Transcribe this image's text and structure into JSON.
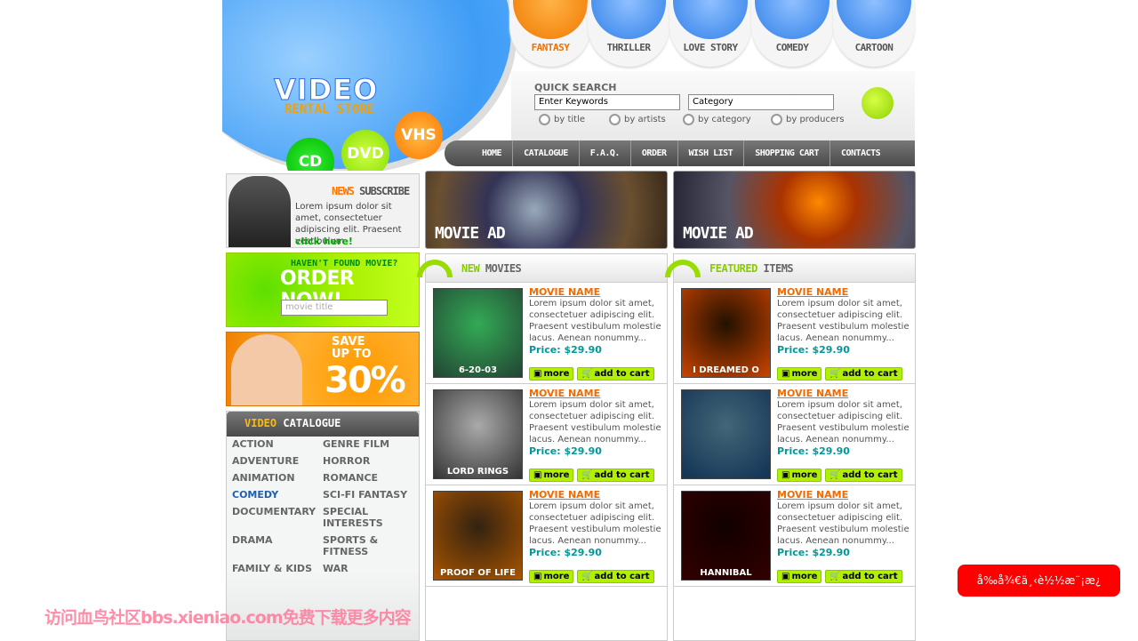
{
  "logo": {
    "title": "VIDEO",
    "subtitle": "RENTAL STORE"
  },
  "media": [
    "CD",
    "DVD",
    "VHS"
  ],
  "genres": [
    {
      "label": "FANTASY",
      "active": true
    },
    {
      "label": "THRILLER"
    },
    {
      "label": "LOVE STORY"
    },
    {
      "label": "COMEDY"
    },
    {
      "label": "CARTOON"
    }
  ],
  "search": {
    "title": "QUICK SEARCH",
    "keywords": "Enter Keywords",
    "category": "Category",
    "options": [
      "by title",
      "by artists",
      "by category",
      "by producers"
    ]
  },
  "nav": [
    "HOME",
    "CATALOGUE",
    "F.A.Q.",
    "ORDER",
    "WISH LIST",
    "SHOPPING CART",
    "CONTACTS"
  ],
  "news": {
    "title_a": "NEWS",
    "title_b": "SUBSCRIBE",
    "text": "Lorem ipsum dolor sit amet, consectetuer adipiscing elit. Praesent vestibulum",
    "link": "click here!"
  },
  "order": {
    "line1": "HAVEN'T FOUND MOVIE?",
    "line2": "ORDER NOW!",
    "placeholder": "movie title"
  },
  "save": {
    "line1": "SAVE",
    "line2": "UP TO",
    "line3": "30%"
  },
  "catalogue": {
    "title_a": "VIDEO",
    "title_b": "CATALOGUE",
    "left": [
      "ACTION",
      "ADVENTURE",
      "ANIMATION",
      "COMEDY",
      "DOCUMENTARY",
      "DRAMA",
      "FAMILY & KIDS"
    ],
    "right": [
      "GENRE FILM",
      "HORROR",
      "ROMANCE",
      "SCI-FI FANTASY",
      "SPECIAL INTERESTS",
      "SPORTS & FITNESS",
      "WAR"
    ],
    "active": "COMEDY",
    "active_color": "#1f5fb0"
  },
  "ads": [
    "MOVIE AD",
    "MOVIE AD"
  ],
  "panels": [
    {
      "title_a": "NEW",
      "title_b": "MOVIES",
      "items": [
        {
          "name": "MOVIE NAME",
          "desc": "Lorem ipsum dolor sit amet, consectetuer adipiscing elit. Praesent vestibulum molestie lacus. Aenean nonummy...",
          "price": "Price: $29.90",
          "poster": "6-20-03"
        },
        {
          "name": "MOVIE NAME",
          "desc": "Lorem ipsum dolor sit amet, consectetuer adipiscing elit. Praesent vestibulum molestie lacus. Aenean nonummy...",
          "price": "Price: $29.90",
          "poster": "LORD RINGS"
        },
        {
          "name": "MOVIE NAME",
          "desc": "Lorem ipsum dolor sit amet, consectetuer adipiscing elit. Praesent vestibulum molestie lacus. Aenean nonummy...",
          "price": "Price: $29.90",
          "poster": "PROOF OF LIFE"
        }
      ]
    },
    {
      "title_a": "FEATURED",
      "title_b": "ITEMS",
      "items": [
        {
          "name": "MOVIE NAME",
          "desc": "Lorem ipsum dolor sit amet, consectetuer adipiscing elit. Praesent vestibulum molestie lacus. Aenean nonummy...",
          "price": "Price: $29.90",
          "poster": "I DREAMED O"
        },
        {
          "name": "MOVIE NAME",
          "desc": "Lorem ipsum dolor sit amet, consectetuer adipiscing elit. Praesent vestibulum molestie lacus. Aenean nonummy...",
          "price": "Price: $29.90",
          "poster": ""
        },
        {
          "name": "MOVIE NAME",
          "desc": "Lorem ipsum dolor sit amet, consectetuer adipiscing elit. Praesent vestibulum molestie lacus. Aenean nonummy...",
          "price": "Price: $29.90",
          "poster": "HANNIBAL"
        }
      ]
    }
  ],
  "buttons": {
    "more": "more",
    "cart": "add to cart"
  },
  "watermark": "访问血鸟社区bbs.xieniao.com免费下载更多内容",
  "red_button": "å‰å¾€ä¸‹è½½æ¨¡æ¿"
}
